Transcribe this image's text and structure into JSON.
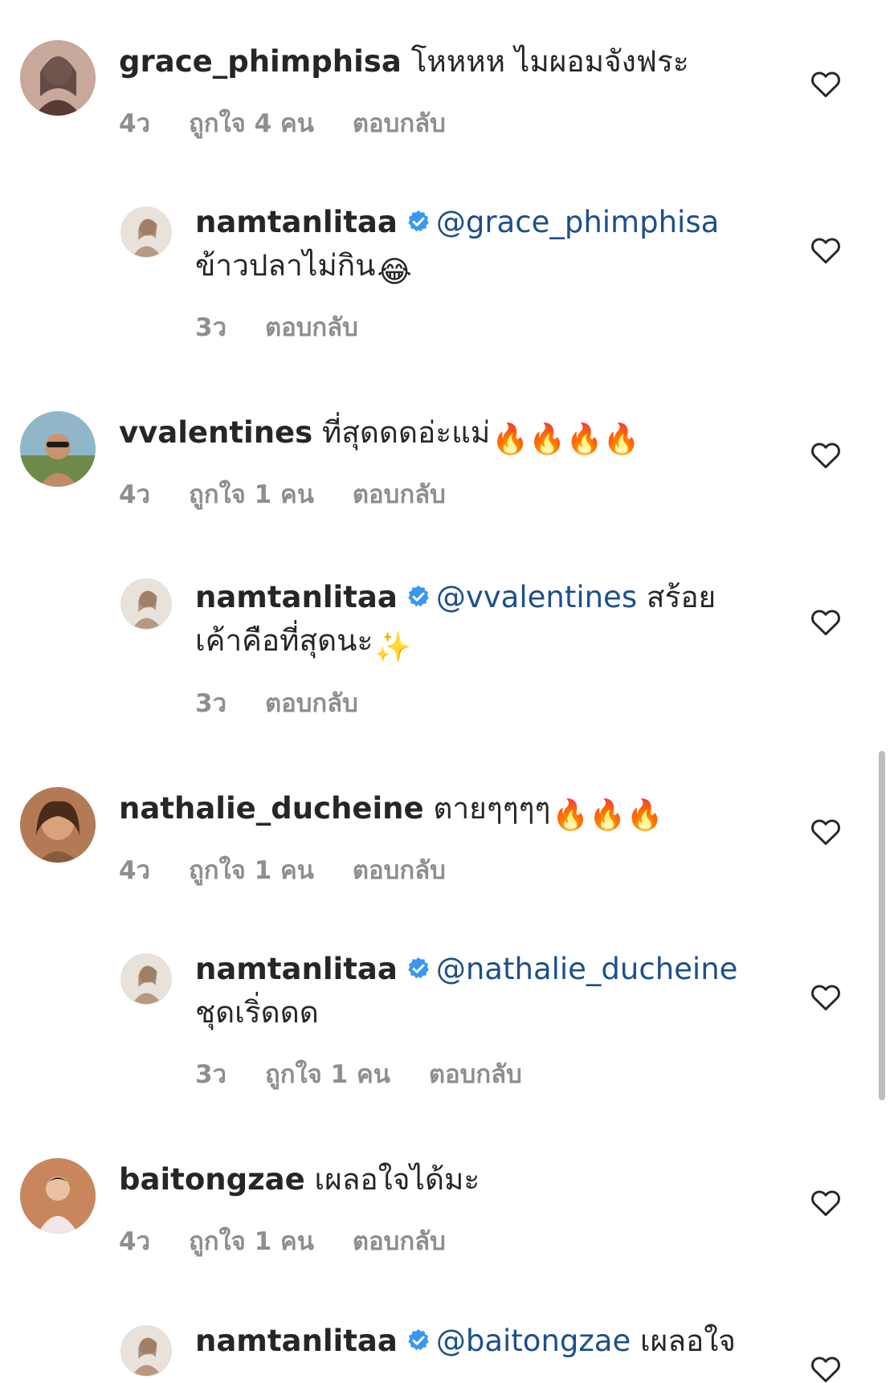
{
  "comments": [
    {
      "username": "grace_phimphisa",
      "text": "โหหหห ไมผอมจังฟระ",
      "time": "4ว",
      "likes": "ถูกใจ 4 คน",
      "reply_label": "ตอบกลับ"
    },
    {
      "username": "namtanlitaa",
      "mention": "@grace_phimphisa",
      "text": "ข้าวปลาไม่กิน",
      "emoji": "😂",
      "time": "3ว",
      "reply_label": "ตอบกลับ"
    },
    {
      "username": "vvalentines",
      "text": "ที่สุดดดอ่ะแม่",
      "emoji": "🔥🔥🔥🔥",
      "time": "4ว",
      "likes": "ถูกใจ 1 คน",
      "reply_label": "ตอบกลับ"
    },
    {
      "username": "namtanlitaa",
      "mention": "@vvalentines",
      "text_inline": "สร้อย",
      "text": "เค้าคือที่สุดนะ",
      "emoji": "✨",
      "time": "3ว",
      "reply_label": "ตอบกลับ"
    },
    {
      "username": "nathalie_ducheine",
      "text": "ตายๆๆๆๆ",
      "emoji": "🔥🔥🔥",
      "time": "4ว",
      "likes": "ถูกใจ 1 คน",
      "reply_label": "ตอบกลับ"
    },
    {
      "username": "namtanlitaa",
      "mention": "@nathalie_ducheine",
      "text": "ชุดเริ่ดดด",
      "time": "3ว",
      "likes": "ถูกใจ 1 คน",
      "reply_label": "ตอบกลับ"
    },
    {
      "username": "baitongzae",
      "text": "เผลอใจได้มะ",
      "time": "4ว",
      "likes": "ถูกใจ 1 คน",
      "reply_label": "ตอบกลับ"
    },
    {
      "username": "namtanlitaa",
      "mention": "@baitongzae",
      "text_inline": "เผลอใจ"
    }
  ],
  "colors": {
    "mention": "#1d4f8c",
    "verified": "#3897f0",
    "meta": "#8e8e8e"
  },
  "icons": {
    "heart": "heart-outline-icon",
    "verified": "verified-badge-icon"
  }
}
